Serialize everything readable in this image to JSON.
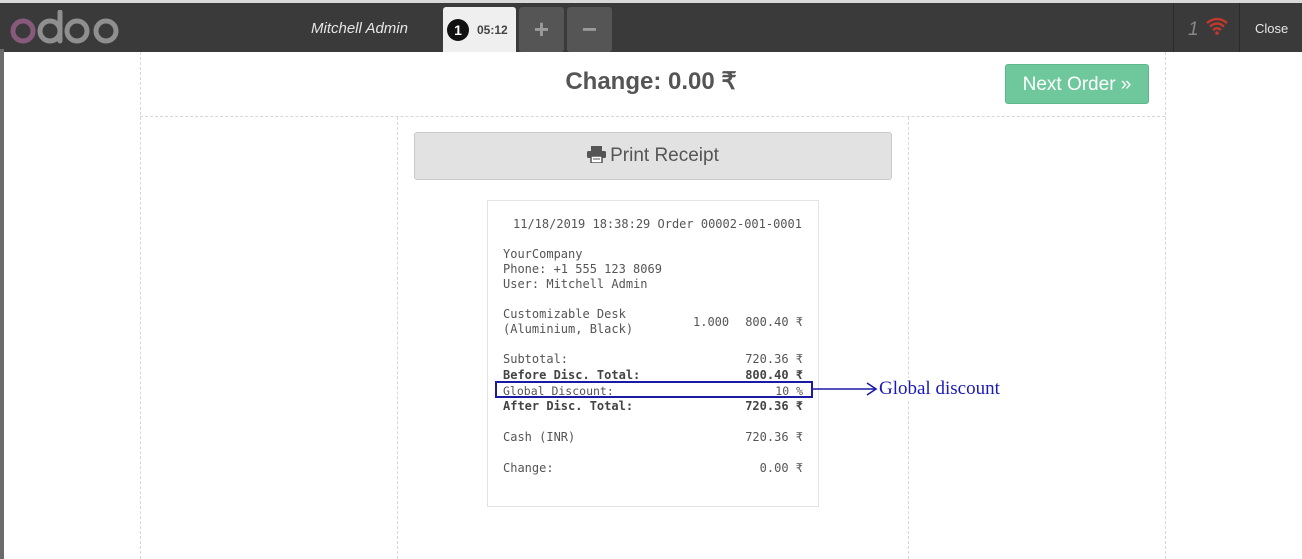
{
  "header": {
    "logo_text": "odoo",
    "cashier": "Mitchell Admin",
    "order_tab": {
      "number": "1",
      "time": "05:12"
    },
    "add_label": "+",
    "remove_label": "−",
    "network_count": "1",
    "close_label": "Close"
  },
  "payment": {
    "change_title": "Change: 0.00 ₹",
    "next_order_label": "Next Order »",
    "print_label": "Print Receipt"
  },
  "receipt": {
    "header_line": "11/18/2019 18:38:29 Order 00002-001-0001",
    "company": "YourCompany",
    "phone": "Phone: +1 555 123 8069",
    "user": "User: Mitchell Admin",
    "product_line1": "Customizable Desk",
    "product_line2": "(Aluminium, Black)",
    "product_qty": "1.000",
    "product_price": "800.40 ₹",
    "subtotal_label": "Subtotal:",
    "subtotal_value": "720.36 ₹",
    "before_label": "Before Disc. Total:",
    "before_value": "800.40 ₹",
    "discount_label": "Global Discount:",
    "discount_value": "10 %",
    "after_label": "After Disc. Total:",
    "after_value": "720.36 ₹",
    "cash_label": "Cash (INR)",
    "cash_value": "720.36 ₹",
    "change_label": "Change:",
    "change_value": "0.00 ₹"
  },
  "annotation": {
    "text": "Global  discount",
    "color": "#1a1ab8"
  },
  "colors": {
    "logo": "#875a7b",
    "accent_green": "#6ec89b",
    "wifi": "#c0392b"
  }
}
